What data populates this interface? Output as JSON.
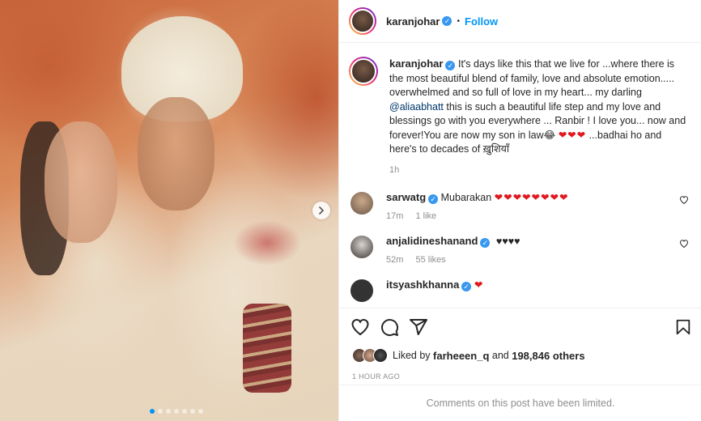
{
  "post": {
    "author": "karanjohar",
    "follow_label": "Follow",
    "separator": "•",
    "caption": {
      "p1": "It's days like this that we live for ...where there is the most beautiful blend of family, love and absolute emotion..... overwhelmed and so full of love in my heart... my darling ",
      "mention": "@aliaabhatt",
      "p2": " this is such a beautiful life step and my love and blessings go with you everywhere ... Ranbir ! I love you... now and forever!You are now my son in law😂 ",
      "hearts": "❤❤❤",
      "p3": " ...badhai ho and here's to decades of ख़ुशियाँ",
      "time": "1h"
    },
    "comments": [
      {
        "user": "sarwatg",
        "text": "Mubarakan ",
        "hearts": "❤❤❤❤❤❤❤❤",
        "time": "17m",
        "likes": "1 like"
      },
      {
        "user": "anjalidineshanand",
        "text": "♥♥♥♥",
        "time": "52m",
        "likes": "55 likes"
      },
      {
        "user": "itsyashkhanna",
        "hearts": "❤"
      }
    ],
    "liked_by": {
      "prefix": "Liked by ",
      "user": "farheeen_q",
      "middle": " and ",
      "others": "198,846 others"
    },
    "timestamp": "1 HOUR AGO",
    "comments_limited": "Comments on this post have been limited.",
    "carousel": {
      "slides": 7,
      "active_index": 0
    }
  },
  "colors": {
    "accent": "#0095f6",
    "heart": "#e0191f",
    "verified": "#3897f0"
  },
  "icons": [
    "verified-icon",
    "heart-icon",
    "comment-icon",
    "share-icon",
    "bookmark-icon",
    "chevron-right-icon"
  ]
}
